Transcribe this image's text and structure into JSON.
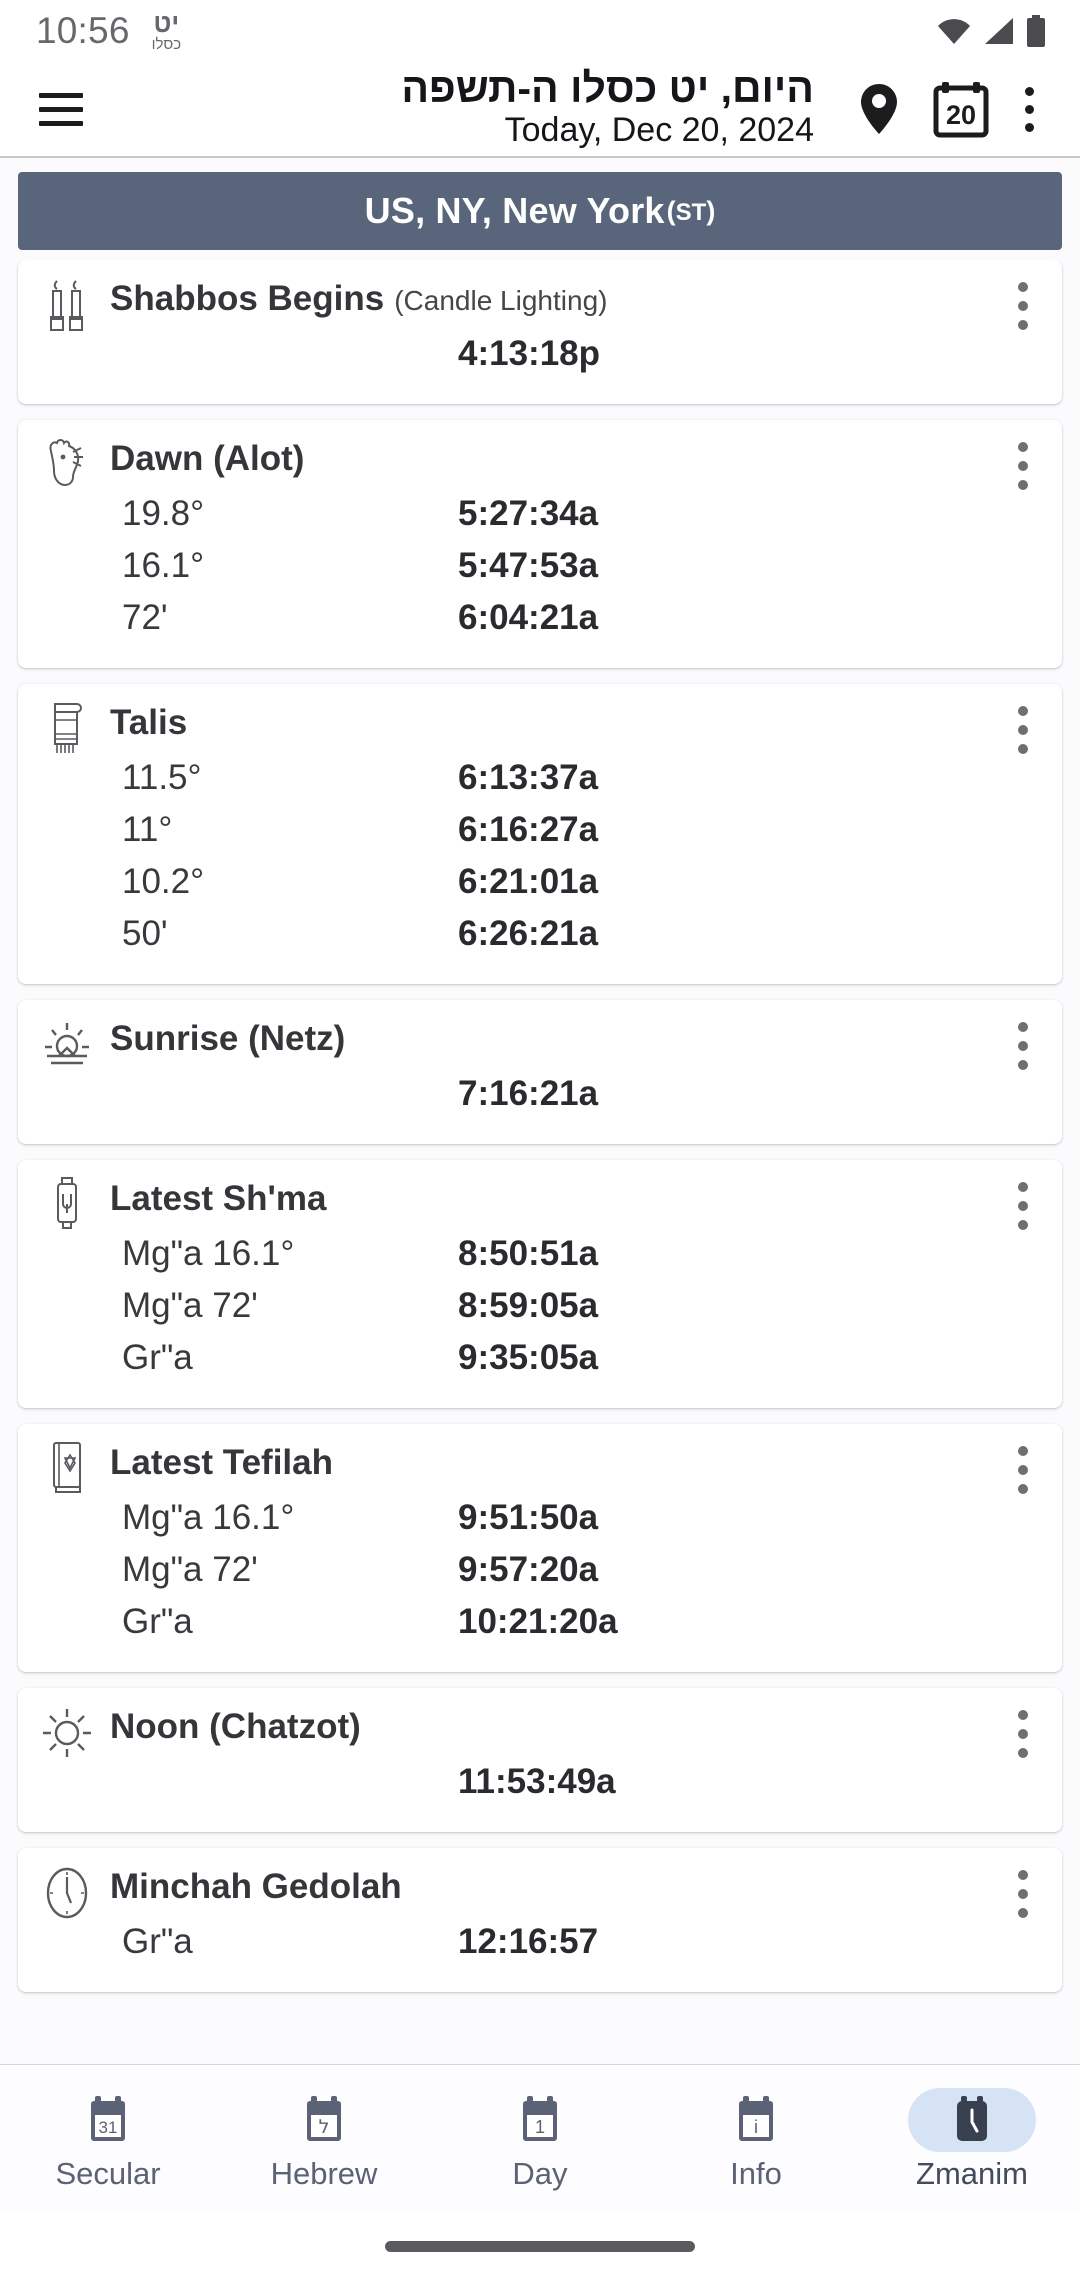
{
  "status_bar": {
    "clock": "10:56",
    "hebrew_day": "יט",
    "hebrew_month": "כסלו",
    "icons": [
      "wifi-icon",
      "cellular-signal-icon",
      "battery-icon"
    ]
  },
  "app_bar": {
    "menu_icon": "hamburger-menu-icon",
    "title_hebrew": "היום, יט כסלו ה-תשפה",
    "title_english": "Today, Dec 20, 2024",
    "location_icon": "location-pin-icon",
    "calendar_icon": "calendar-icon",
    "calendar_day": "20",
    "overflow_icon": "overflow-menu-icon"
  },
  "location_banner": {
    "text": "US, NY, New York",
    "timezone": "(ST)",
    "background": "#59657a",
    "text_color": "#ffffff"
  },
  "zmanim": [
    {
      "icon": "candles-icon",
      "title": "Shabbos Begins",
      "subtitle": "(Candle Lighting)",
      "rows": [
        {
          "label": "",
          "value": "4:13:18p"
        }
      ]
    },
    {
      "icon": "rooster-icon",
      "title": "Dawn (Alot)",
      "subtitle": "",
      "rows": [
        {
          "label": "19.8°",
          "value": "5:27:34a"
        },
        {
          "label": "16.1°",
          "value": "5:47:53a"
        },
        {
          "label": "72'",
          "value": "6:04:21a"
        }
      ]
    },
    {
      "icon": "talis-icon",
      "title": "Talis",
      "subtitle": "",
      "rows": [
        {
          "label": "11.5°",
          "value": "6:13:37a"
        },
        {
          "label": "11°",
          "value": "6:16:27a"
        },
        {
          "label": "10.2°",
          "value": "6:21:01a"
        },
        {
          "label": "50'",
          "value": "6:26:21a"
        }
      ]
    },
    {
      "icon": "sunrise-icon",
      "title": "Sunrise (Netz)",
      "subtitle": "",
      "rows": [
        {
          "label": "",
          "value": "7:16:21a"
        }
      ]
    },
    {
      "icon": "mezuzah-icon",
      "title": "Latest Sh'ma",
      "subtitle": "",
      "rows": [
        {
          "label": "Mg\"a 16.1°",
          "value": "8:50:51a"
        },
        {
          "label": "Mg\"a 72'",
          "value": "8:59:05a"
        },
        {
          "label": "Gr\"a",
          "value": "9:35:05a"
        }
      ]
    },
    {
      "icon": "siddur-icon",
      "title": "Latest Tefilah",
      "subtitle": "",
      "rows": [
        {
          "label": "Mg\"a 16.1°",
          "value": "9:51:50a"
        },
        {
          "label": "Mg\"a 72'",
          "value": "9:57:20a"
        },
        {
          "label": "Gr\"a",
          "value": "10:21:20a"
        }
      ]
    },
    {
      "icon": "sun-icon",
      "title": "Noon (Chatzot)",
      "subtitle": "",
      "rows": [
        {
          "label": "",
          "value": "11:53:49a"
        }
      ]
    },
    {
      "icon": "clock-icon",
      "title": "Minchah Gedolah",
      "subtitle": "",
      "rows": [
        {
          "label": "Gr\"a",
          "value": "12:16:57"
        }
      ]
    }
  ],
  "bottom_nav": {
    "items": [
      {
        "label": "Secular",
        "icon": "calendar-31-icon",
        "glyph": "31",
        "active": false
      },
      {
        "label": "Hebrew",
        "icon": "calendar-hebrew-icon",
        "glyph": "ל",
        "active": false
      },
      {
        "label": "Day",
        "icon": "calendar-1-icon",
        "glyph": "1",
        "active": false
      },
      {
        "label": "Info",
        "icon": "info-icon",
        "glyph": "i",
        "active": false
      },
      {
        "label": "Zmanim",
        "icon": "clock-icon",
        "glyph": "",
        "active": true
      }
    ],
    "active_pill_color": "#d6e3f5"
  },
  "gesture_bar": {
    "present": true
  }
}
